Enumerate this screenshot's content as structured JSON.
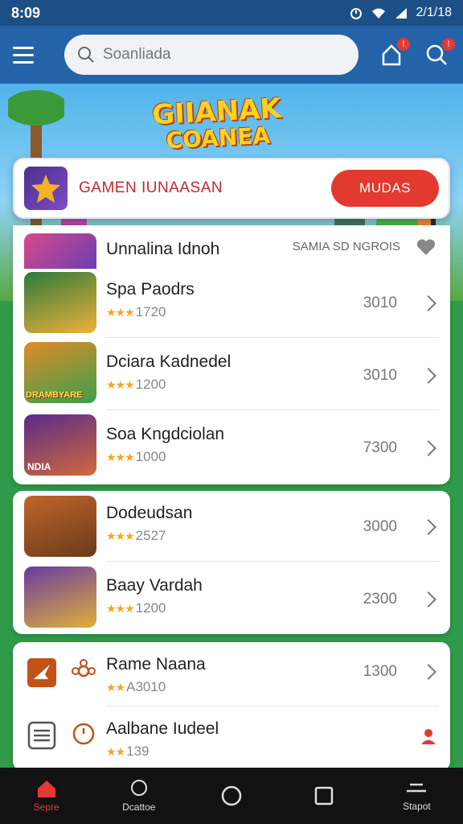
{
  "status": {
    "time": "8:09",
    "right_text": "2/1/18"
  },
  "search": {
    "placeholder": "Soanliada"
  },
  "banner": {
    "title_line1": "GIIANAK",
    "title_line2": "COANEA"
  },
  "featured": {
    "name": "GAMEN IUNAASAN",
    "button": "MUDAS"
  },
  "list_header": {
    "name": "Unnalina Idnoh",
    "meta": "SAMIA SD NGROIS"
  },
  "section1": [
    {
      "name": "Spa Paodrs",
      "stars": "★★★",
      "rating": "1720",
      "value": "3010"
    },
    {
      "name": "Dciara Kadnedel",
      "stars": "★★★",
      "rating": "1200",
      "value": "3010"
    },
    {
      "name": "Soa Kngdciolan",
      "stars": "★★★",
      "rating": "1000",
      "value": "7300"
    }
  ],
  "section2": [
    {
      "name": "Dodeudsan",
      "stars": "★★★",
      "rating": "2527",
      "value": "3000"
    },
    {
      "name": "Baay Vardah",
      "stars": "★★★",
      "rating": "1200",
      "value": "2300"
    }
  ],
  "section3": [
    {
      "name": "Rame Naana",
      "stars": "★★",
      "rating": "A3010",
      "value": "1300"
    },
    {
      "name": "Aalbane Iudeel",
      "stars": "★★",
      "rating": "139",
      "value": ""
    }
  ],
  "icon_labels": {
    "card1_icon": "DRAMBYARE",
    "card3_icon": "NDIA"
  },
  "nav": [
    {
      "label": "Sepre"
    },
    {
      "label": "Dcattoe"
    },
    {
      "label": ""
    },
    {
      "label": ""
    },
    {
      "label": "Stapot"
    }
  ],
  "colors": {
    "appbar": "#2563a8",
    "accent": "#e23a2e",
    "star": "#f5a623"
  }
}
